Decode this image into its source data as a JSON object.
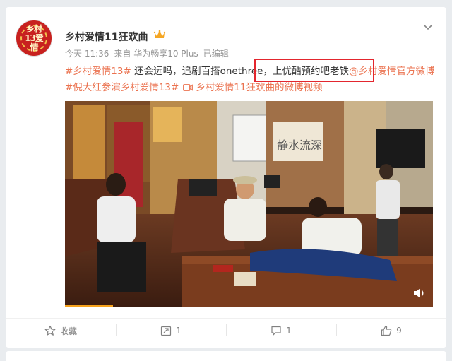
{
  "post": {
    "author": "乡村爱情11狂欢曲",
    "avatar_text": "乡村13爱情",
    "meta": {
      "date": "今天 11:36",
      "source": "来自 华为畅享10 Plus",
      "edited": "已编辑"
    },
    "text": {
      "tag1": "#乡村爱情13#",
      "body1": " 还会远吗，追剧百搭onethree，上优酷预约吧老铁",
      "mention": "@乡村爱情官方微博",
      "space": " ",
      "tag2": "#倪大红参演乡村爱情13#",
      "video_link": "乡村爱情11狂欢曲的微博视频"
    },
    "video": {
      "sign_text": "静水流深",
      "progress_fraction": 0.13
    }
  },
  "actions": {
    "favorite_label": "收藏",
    "repost_count": "1",
    "comment_count": "1",
    "like_count": "9"
  },
  "colors": {
    "accent": "#eb7350",
    "highlight_box": "#e3262e",
    "progress": "#f6a21c"
  }
}
